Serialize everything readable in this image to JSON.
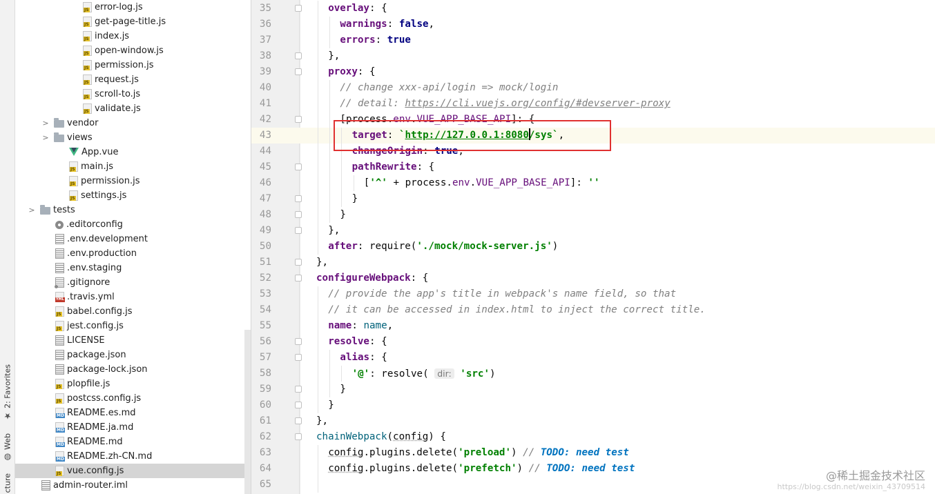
{
  "tool_strip": {
    "tabs": [
      {
        "label": "2: Favorites",
        "icon": "star-icon"
      },
      {
        "label": "Web",
        "icon": "globe-icon"
      },
      {
        "label": "cture",
        "icon": "structure-icon"
      }
    ]
  },
  "project_tree": {
    "items": [
      {
        "label": "error-log.js",
        "icon": "js",
        "indent": 104,
        "arrow": ""
      },
      {
        "label": "get-page-title.js",
        "icon": "js",
        "indent": 104,
        "arrow": ""
      },
      {
        "label": "index.js",
        "icon": "js",
        "indent": 104,
        "arrow": ""
      },
      {
        "label": "open-window.js",
        "icon": "js",
        "indent": 104,
        "arrow": ""
      },
      {
        "label": "permission.js",
        "icon": "js",
        "indent": 104,
        "arrow": ""
      },
      {
        "label": "request.js",
        "icon": "js",
        "indent": 104,
        "arrow": ""
      },
      {
        "label": "scroll-to.js",
        "icon": "js",
        "indent": 104,
        "arrow": ""
      },
      {
        "label": "validate.js",
        "icon": "js",
        "indent": 104,
        "arrow": ""
      },
      {
        "label": "vendor",
        "icon": "folder",
        "indent": 62,
        "arrow": "›"
      },
      {
        "label": "views",
        "icon": "folder",
        "indent": 62,
        "arrow": "›"
      },
      {
        "label": "App.vue",
        "icon": "vue",
        "indent": 84,
        "arrow": ""
      },
      {
        "label": "main.js",
        "icon": "js",
        "indent": 84,
        "arrow": ""
      },
      {
        "label": "permission.js",
        "icon": "js",
        "indent": 84,
        "arrow": ""
      },
      {
        "label": "settings.js",
        "icon": "js",
        "indent": 84,
        "arrow": ""
      },
      {
        "label": "tests",
        "icon": "folder",
        "indent": 42,
        "arrow": "›"
      },
      {
        "label": ".editorconfig",
        "icon": "gear",
        "indent": 64,
        "arrow": ""
      },
      {
        "label": ".env.development",
        "icon": "txt",
        "indent": 64,
        "arrow": ""
      },
      {
        "label": ".env.production",
        "icon": "txt",
        "indent": 64,
        "arrow": ""
      },
      {
        "label": ".env.staging",
        "icon": "txt",
        "indent": 64,
        "arrow": ""
      },
      {
        "label": ".gitignore",
        "icon": "gitignore",
        "indent": 64,
        "arrow": ""
      },
      {
        "label": ".travis.yml",
        "icon": "yml",
        "indent": 64,
        "arrow": ""
      },
      {
        "label": "babel.config.js",
        "icon": "js",
        "indent": 64,
        "arrow": ""
      },
      {
        "label": "jest.config.js",
        "icon": "js",
        "indent": 64,
        "arrow": ""
      },
      {
        "label": "LICENSE",
        "icon": "txt",
        "indent": 64,
        "arrow": ""
      },
      {
        "label": "package.json",
        "icon": "txt",
        "indent": 64,
        "arrow": ""
      },
      {
        "label": "package-lock.json",
        "icon": "txt",
        "indent": 64,
        "arrow": ""
      },
      {
        "label": "plopfile.js",
        "icon": "js",
        "indent": 64,
        "arrow": ""
      },
      {
        "label": "postcss.config.js",
        "icon": "js",
        "indent": 64,
        "arrow": ""
      },
      {
        "label": "README.es.md",
        "icon": "md",
        "indent": 64,
        "arrow": ""
      },
      {
        "label": "README.ja.md",
        "icon": "md",
        "indent": 64,
        "arrow": ""
      },
      {
        "label": "README.md",
        "icon": "md",
        "indent": 64,
        "arrow": ""
      },
      {
        "label": "README.zh-CN.md",
        "icon": "md",
        "indent": 64,
        "arrow": ""
      },
      {
        "label": "vue.config.js",
        "icon": "js",
        "indent": 64,
        "arrow": "",
        "selected": true
      },
      {
        "label": "admin-router.iml",
        "icon": "txt",
        "indent": 44,
        "arrow": ""
      }
    ]
  },
  "editor": {
    "current_line": 43,
    "lines": [
      {
        "n": 35,
        "fold": true,
        "guides": [
          1
        ],
        "t": [
          [
            "pr",
            "overlay"
          ],
          [
            "",
            "{: {"
          ]
        ]
      },
      {
        "n": 36,
        "fold": false,
        "guides": [
          1,
          2
        ],
        "t": [
          [
            "pr",
            "warnings"
          ],
          [
            "",
            ": "
          ],
          [
            "kw",
            "false"
          ],
          [
            "",
            ","
          ]
        ]
      },
      {
        "n": 37,
        "fold": false,
        "guides": [
          1,
          2
        ],
        "t": [
          [
            "pr",
            "errors"
          ],
          [
            "",
            ": "
          ],
          [
            "kw",
            "true"
          ]
        ]
      },
      {
        "n": 38,
        "fold": true,
        "guides": [
          1
        ],
        "t": [
          [
            "",
            "},"
          ]
        ]
      },
      {
        "n": 39,
        "fold": true,
        "guides": [
          1
        ],
        "t": [
          [
            "pr",
            "proxy"
          ],
          [
            "",
            ": {"
          ]
        ]
      },
      {
        "n": 40,
        "fold": false,
        "guides": [
          1,
          2
        ],
        "t": [
          [
            "cm",
            "// change xxx-api/login => mock/login"
          ]
        ]
      },
      {
        "n": 41,
        "fold": false,
        "guides": [
          1,
          2
        ],
        "t": [
          [
            "cm",
            "// detail: "
          ],
          [
            "cmlink",
            "https://cli.vuejs.org/config/#devserver-proxy"
          ]
        ]
      },
      {
        "n": 42,
        "fold": true,
        "guides": [
          1,
          2
        ],
        "t": [
          [
            "",
            "["
          ],
          [
            "",
            "process."
          ],
          [
            "pv",
            "env"
          ],
          [
            "",
            "."
          ],
          [
            "pv",
            "VUE_APP_BASE_API"
          ],
          [
            "",
            "]: {"
          ]
        ]
      },
      {
        "n": 43,
        "fold": false,
        "guides": [
          1,
          2,
          3
        ],
        "t": [
          [
            "pr",
            "target"
          ],
          [
            "",
            ": "
          ],
          [
            "st",
            "`"
          ],
          [
            "url",
            "http://127.0.0.1:8080"
          ],
          [
            "caret",
            ""
          ],
          [
            "st",
            "/sys`"
          ],
          [
            "",
            ","
          ]
        ]
      },
      {
        "n": 44,
        "fold": false,
        "guides": [
          1,
          2,
          3
        ],
        "t": [
          [
            "pr",
            "changeOrigin"
          ],
          [
            "",
            ": "
          ],
          [
            "kw",
            "true"
          ],
          [
            "",
            ","
          ]
        ]
      },
      {
        "n": 45,
        "fold": true,
        "guides": [
          1,
          2,
          3
        ],
        "t": [
          [
            "pr",
            "pathRewrite"
          ],
          [
            "",
            ": {"
          ]
        ]
      },
      {
        "n": 46,
        "fold": false,
        "guides": [
          1,
          2,
          3,
          4
        ],
        "t": [
          [
            "",
            "["
          ],
          [
            "st",
            "'^'"
          ],
          [
            "",
            " + process."
          ],
          [
            "pv",
            "env"
          ],
          [
            "",
            "."
          ],
          [
            "pv",
            "VUE_APP_BASE_API"
          ],
          [
            "",
            "]: "
          ],
          [
            "st",
            "''"
          ]
        ]
      },
      {
        "n": 47,
        "fold": true,
        "guides": [
          1,
          2,
          3
        ],
        "t": [
          [
            "",
            "}"
          ]
        ]
      },
      {
        "n": 48,
        "fold": true,
        "guides": [
          1,
          2
        ],
        "t": [
          [
            "",
            "}"
          ]
        ]
      },
      {
        "n": 49,
        "fold": true,
        "guides": [
          1
        ],
        "t": [
          [
            "",
            "},"
          ]
        ]
      },
      {
        "n": 50,
        "fold": false,
        "guides": [
          1
        ],
        "t": [
          [
            "pr",
            "after"
          ],
          [
            "",
            ": require("
          ],
          [
            "st",
            "'./mock/mock-server.js'"
          ],
          [
            "",
            ")"
          ]
        ]
      },
      {
        "n": 51,
        "fold": true,
        "guides": [],
        "t": [
          [
            "",
            "},"
          ]
        ]
      },
      {
        "n": 52,
        "fold": true,
        "guides": [],
        "t": [
          [
            "pr",
            "configureWebpack"
          ],
          [
            "",
            ": {"
          ]
        ]
      },
      {
        "n": 53,
        "fold": false,
        "guides": [
          1
        ],
        "t": [
          [
            "cm",
            "// provide the app's title in webpack's name field, so that"
          ]
        ]
      },
      {
        "n": 54,
        "fold": false,
        "guides": [
          1
        ],
        "t": [
          [
            "cm",
            "// it can be accessed in index.html to inject the correct title."
          ]
        ]
      },
      {
        "n": 55,
        "fold": false,
        "guides": [
          1
        ],
        "t": [
          [
            "pr",
            "name"
          ],
          [
            "",
            ": "
          ],
          [
            "fn",
            "name"
          ],
          [
            "",
            ","
          ]
        ]
      },
      {
        "n": 56,
        "fold": true,
        "guides": [
          1
        ],
        "t": [
          [
            "pr",
            "resolve"
          ],
          [
            "",
            ": {"
          ]
        ]
      },
      {
        "n": 57,
        "fold": true,
        "guides": [
          1,
          2
        ],
        "t": [
          [
            "pr",
            "alias"
          ],
          [
            "",
            ": {"
          ]
        ]
      },
      {
        "n": 58,
        "fold": false,
        "guides": [
          1,
          2,
          3
        ],
        "t": [
          [
            "st",
            "'@'"
          ],
          [
            "",
            ": resolve( "
          ],
          [
            "hint",
            "dir:"
          ],
          [
            "",
            ""
          ],
          [
            "st",
            " 'src'"
          ],
          [
            "",
            ")"
          ]
        ]
      },
      {
        "n": 59,
        "fold": true,
        "guides": [
          1,
          2
        ],
        "t": [
          [
            "",
            "}"
          ]
        ]
      },
      {
        "n": 60,
        "fold": true,
        "guides": [
          1
        ],
        "t": [
          [
            "",
            "}"
          ]
        ]
      },
      {
        "n": 61,
        "fold": true,
        "guides": [],
        "t": [
          [
            "",
            "},"
          ]
        ]
      },
      {
        "n": 62,
        "fold": true,
        "guides": [],
        "t": [
          [
            "fn",
            "chainWebpack"
          ],
          [
            "",
            "("
          ],
          [
            "u",
            "config"
          ],
          [
            "",
            ") {"
          ]
        ]
      },
      {
        "n": 63,
        "fold": false,
        "guides": [
          1
        ],
        "t": [
          [
            "u",
            "config"
          ],
          [
            "",
            ".plugins.delete("
          ],
          [
            "st",
            "'preload'"
          ],
          [
            "",
            ") "
          ],
          [
            "cm",
            "// "
          ],
          [
            "todo",
            "TODO: need test"
          ]
        ]
      },
      {
        "n": 64,
        "fold": false,
        "guides": [
          1
        ],
        "t": [
          [
            "u",
            "config"
          ],
          [
            "",
            ".plugins.delete("
          ],
          [
            "st",
            "'prefetch'"
          ],
          [
            "",
            ") "
          ],
          [
            "cm",
            "// "
          ],
          [
            "todo",
            "TODO: need test"
          ]
        ]
      },
      {
        "n": 65,
        "fold": false,
        "guides": [
          1
        ],
        "t": [
          [
            "",
            ""
          ]
        ]
      }
    ]
  },
  "watermark": {
    "main": "@稀土掘金技术社区",
    "sub": "https://blog.csdn.net/weixin_43709514"
  }
}
